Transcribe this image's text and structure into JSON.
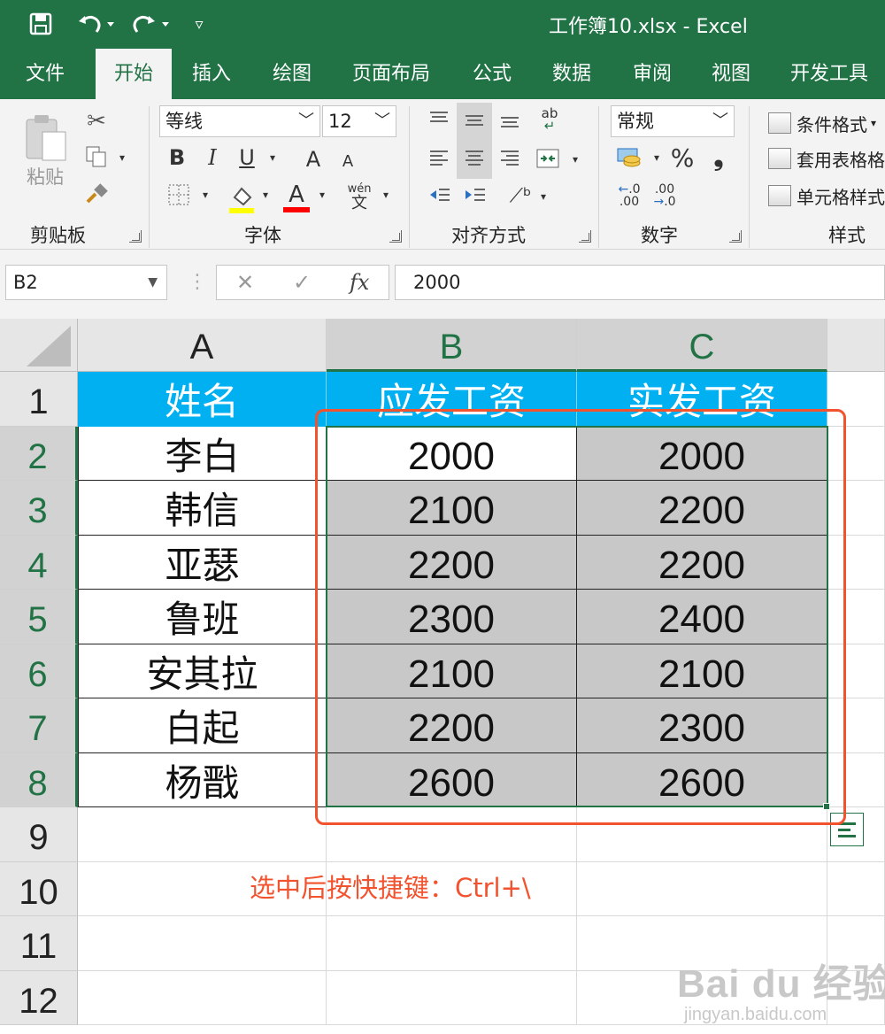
{
  "window": {
    "title": "工作簿10.xlsx  -  Excel",
    "quick_access": [
      {
        "name": "save-icon",
        "glyph": "🖫"
      },
      {
        "name": "undo-icon",
        "glyph": "↶ ▾"
      },
      {
        "name": "redo-icon",
        "glyph": "↷ ▾"
      },
      {
        "name": "customize-qat-icon",
        "glyph": "▿"
      }
    ]
  },
  "ribbon_tabs": [
    {
      "label": "文件",
      "active": false
    },
    {
      "label": "开始",
      "active": true
    },
    {
      "label": "插入",
      "active": false
    },
    {
      "label": "绘图",
      "active": false
    },
    {
      "label": "页面布局",
      "active": false
    },
    {
      "label": "公式",
      "active": false
    },
    {
      "label": "数据",
      "active": false
    },
    {
      "label": "审阅",
      "active": false
    },
    {
      "label": "视图",
      "active": false
    },
    {
      "label": "开发工具",
      "active": false
    }
  ],
  "ribbon": {
    "clipboard": {
      "label": "剪贴板",
      "paste_label": "粘贴"
    },
    "font": {
      "label": "字体",
      "font_name": "等线",
      "font_size": "12",
      "bold": "B",
      "italic": "I",
      "underline": "U",
      "grow_font": "A",
      "shrink_font": "A",
      "font_color_letter": "A",
      "phonetic_top": "wén",
      "phonetic_bottom": "文",
      "highlight_color": "#ffff00",
      "font_color": "#ff0000"
    },
    "alignment": {
      "label": "对齐方式",
      "wrap_text": "ab"
    },
    "number": {
      "label": "数字",
      "format": "常规",
      "percent": "%",
      "comma": "，",
      "inc_decimal": "←.0\n.00",
      "dec_decimal": ".00\n→.0"
    },
    "styles": {
      "label": "样式",
      "conditional_format": "条件格式",
      "format_as_table": "套用表格格",
      "cell_styles": "单元格样式"
    }
  },
  "formula_bar": {
    "name_box": "B2",
    "cancel_glyph": "✕",
    "enter_glyph": "✓",
    "fx": "fx",
    "content": "2000"
  },
  "sheet": {
    "columns": [
      "A",
      "B",
      "C"
    ],
    "rows": [
      "1",
      "2",
      "3",
      "4",
      "5",
      "6",
      "7",
      "8",
      "9",
      "10",
      "11",
      "12"
    ],
    "header": [
      "姓名",
      "应发工资",
      "实发工资"
    ],
    "data": [
      [
        "李白",
        "2000",
        "2000"
      ],
      [
        "韩信",
        "2100",
        "2200"
      ],
      [
        "亚瑟",
        "2200",
        "2200"
      ],
      [
        "鲁班",
        "2300",
        "2400"
      ],
      [
        "安其拉",
        "2100",
        "2100"
      ],
      [
        "白起",
        "2200",
        "2300"
      ],
      [
        "杨戬",
        "2600",
        "2600"
      ]
    ],
    "selected_range": "B2:C8",
    "active_cell": "B2"
  },
  "annotation": {
    "text": "选中后按快捷键：Ctrl+\\",
    "color": "#f2522e"
  },
  "watermark": {
    "brand": "Bai du 经验",
    "url": "jingyan.baidu.com"
  },
  "colors": {
    "excel_green": "#217346",
    "header_fill": "#00b0f0",
    "diff_fill": "#c8c8c8"
  }
}
